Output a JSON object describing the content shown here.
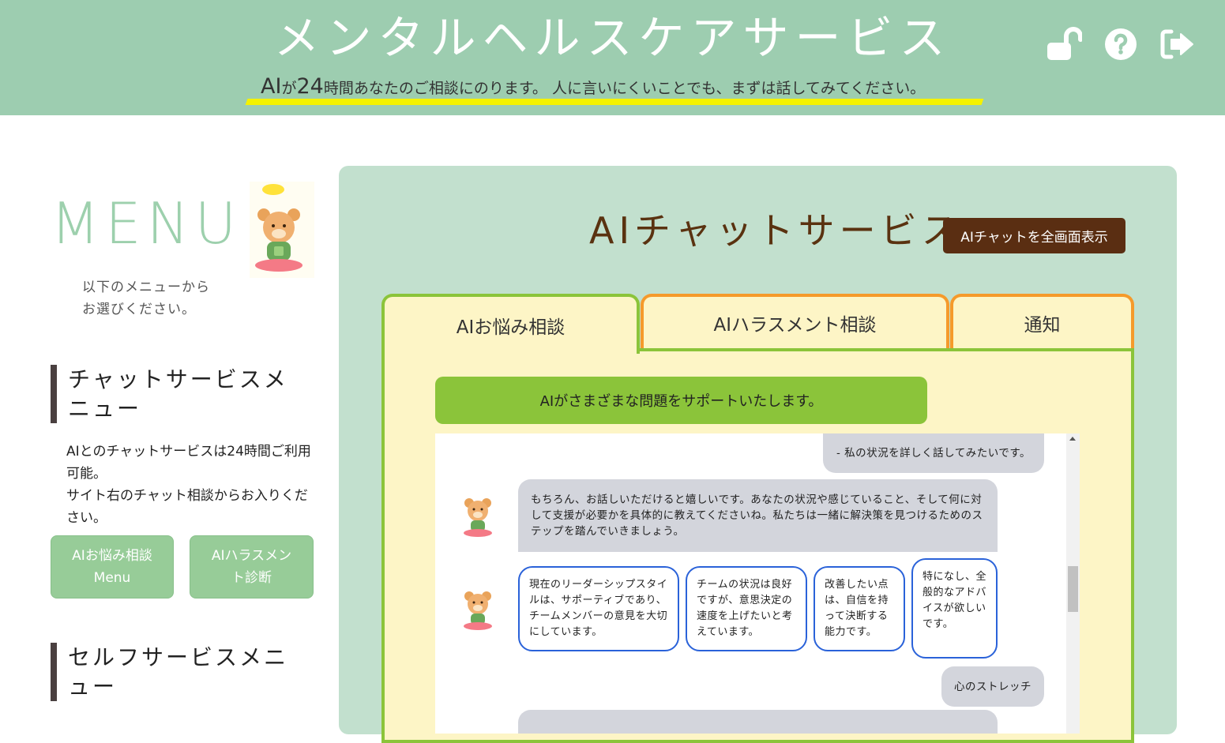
{
  "header": {
    "title": "メンタルヘルスケアサービス",
    "tagline_ai": "AI",
    "tagline_ga": "が",
    "tagline_24": "24",
    "tagline_jikan": "時間",
    "tagline_rest": "あなたのご相談にのります。 人に言いにくいことでも、まずは話してみてください。",
    "icons": [
      "unlock-icon",
      "help-icon",
      "logout-icon"
    ]
  },
  "menu": {
    "title": "MENU",
    "subtitle_line1": "以下のメニューから",
    "subtitle_line2": "お選びください。",
    "chat_section": {
      "heading": "チャットサービスメニュー",
      "desc_line1": "AIとのチャットサービスは24時間ご利用可能。",
      "desc_line2": "サイト右のチャット相談からお入りください。"
    },
    "buttons": {
      "worry_line1": "AIお悩み相談",
      "worry_line2": "Menu",
      "harassment_line1": "AIハラスメン",
      "harassment_line2": "ト診断"
    },
    "self_section": {
      "heading": "セルフサービスメニュー"
    }
  },
  "chat_panel": {
    "title": "AIチャットサービス",
    "fullscreen_label": "AIチャットを全画面表示",
    "tabs": [
      {
        "label": "AIお悩み相談"
      },
      {
        "label": "AIハラスメント相談"
      },
      {
        "label": "通知"
      }
    ],
    "banner": "AIがさまざまな問題をサポートいたします。",
    "messages": {
      "user1": "- 私の状況を詳しく話してみたいです。",
      "ai1": "もちろん、お話しいただけると嬉しいです。あなたの状況や感じていること、そして何に対して支援が必要かを具体的に教えてくださいね。私たちは一緒に解決策を見つけるためのステップを踏んでいきましょう。",
      "user2": "心のストレッチ"
    },
    "options": [
      "現在のリーダーシップスタイルは、サポーティブであり、チームメンバーの意見を大切にしています。",
      "チームの状況は良好ですが、意思決定の速度を上げたいと考えています。",
      "改善したい点は、自信を持って決断する能力です。",
      "特になし、全般的なアドバイスが欲しいです。"
    ]
  },
  "colors": {
    "header_bg": "#9dcdb0",
    "panel_bg": "#c2e0ce",
    "accent_green": "#8bc43a",
    "accent_orange": "#f59a2b",
    "brown": "#5a2e12",
    "highlight": "#f5f200"
  }
}
